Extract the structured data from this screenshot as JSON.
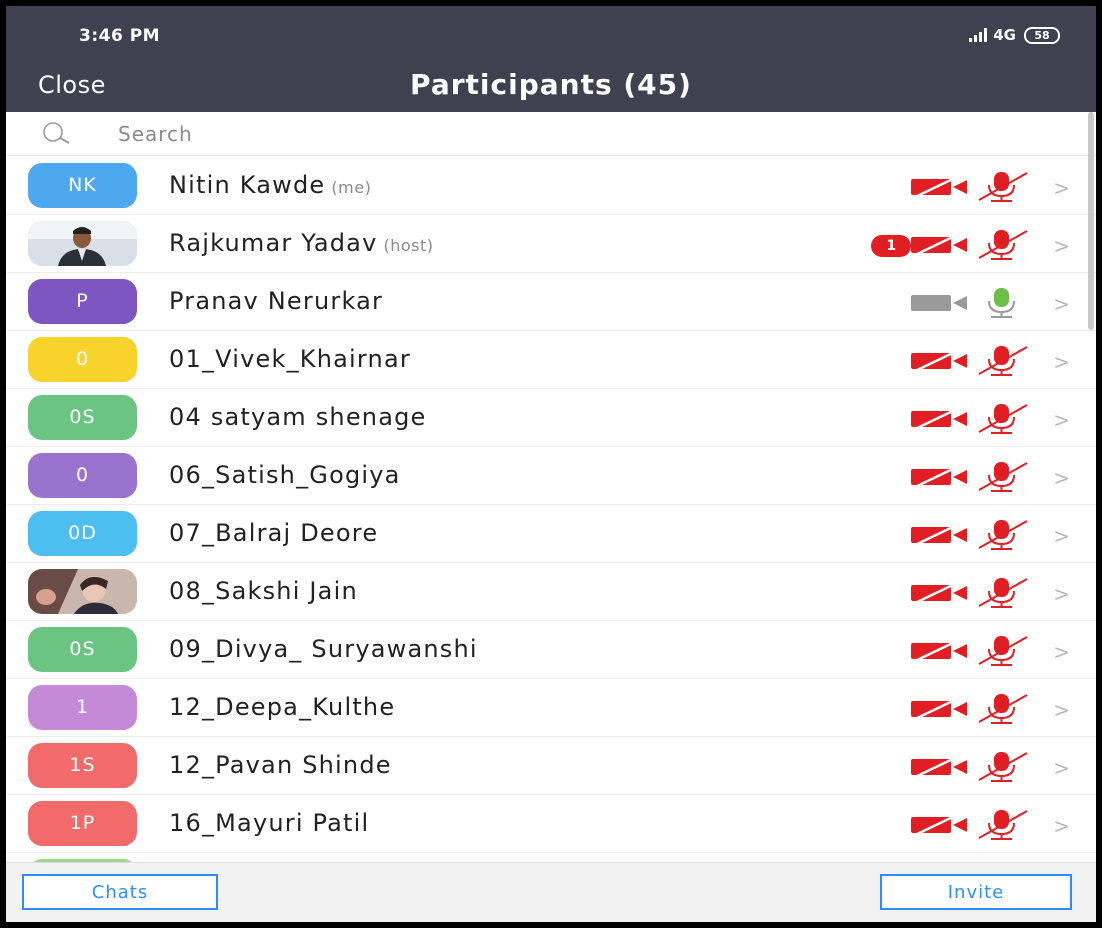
{
  "status_bar": {
    "time": "3:46 PM",
    "network": "4G",
    "battery": "58"
  },
  "header": {
    "close_label": "Close",
    "title": "Participants (45)"
  },
  "search": {
    "placeholder": "Search"
  },
  "colors": {
    "header_bg": "#3f4150",
    "accent": "#2d8cff",
    "muted_red": "#e01e24",
    "active_mic": "#6cc04a"
  },
  "participants": [
    {
      "name": "Nitin Kawde",
      "tag": "(me)",
      "initials": "NK",
      "avatar_color": "#4da8ef",
      "video": "off",
      "audio": "muted",
      "badge": ""
    },
    {
      "name": "Rajkumar Yadav",
      "tag": "(host)",
      "initials": "",
      "avatar_color": "photo",
      "video": "off",
      "audio": "muted",
      "badge": "1"
    },
    {
      "name": "Pranav Nerurkar",
      "tag": "",
      "initials": "P",
      "avatar_color": "#7d56c2",
      "video": "on",
      "audio": "on",
      "badge": ""
    },
    {
      "name": "01_Vivek_Khairnar",
      "tag": "",
      "initials": "0",
      "avatar_color": "#f7d32b",
      "video": "off",
      "audio": "muted",
      "badge": ""
    },
    {
      "name": "04 satyam shenage",
      "tag": "",
      "initials": "0S",
      "avatar_color": "#6cc483",
      "video": "off",
      "audio": "muted",
      "badge": ""
    },
    {
      "name": "06_Satish_Gogiya",
      "tag": "",
      "initials": "0",
      "avatar_color": "#9a73cf",
      "video": "off",
      "audio": "muted",
      "badge": ""
    },
    {
      "name": "07_Balraj Deore",
      "tag": "",
      "initials": "0D",
      "avatar_color": "#4dbef0",
      "video": "off",
      "audio": "muted",
      "badge": ""
    },
    {
      "name": "08_Sakshi Jain",
      "tag": "",
      "initials": "",
      "avatar_color": "photo",
      "video": "off",
      "audio": "muted",
      "badge": ""
    },
    {
      "name": "09_Divya_ Suryawanshi",
      "tag": "",
      "initials": "0S",
      "avatar_color": "#6cc483",
      "video": "off",
      "audio": "muted",
      "badge": ""
    },
    {
      "name": "12_Deepa_Kulthe",
      "tag": "",
      "initials": "1",
      "avatar_color": "#c48ad8",
      "video": "off",
      "audio": "muted",
      "badge": ""
    },
    {
      "name": "12_Pavan Shinde",
      "tag": "",
      "initials": "1S",
      "avatar_color": "#f26b6b",
      "video": "off",
      "audio": "muted",
      "badge": ""
    },
    {
      "name": "16_Mayuri Patil",
      "tag": "",
      "initials": "1P",
      "avatar_color": "#f26b6b",
      "video": "off",
      "audio": "muted",
      "badge": ""
    },
    {
      "name": "",
      "tag": "",
      "initials": "",
      "avatar_color": "#9ed98a",
      "video": "off",
      "audio": "muted",
      "badge": ""
    }
  ],
  "footer": {
    "chats_label": "Chats",
    "invite_label": "Invite"
  }
}
